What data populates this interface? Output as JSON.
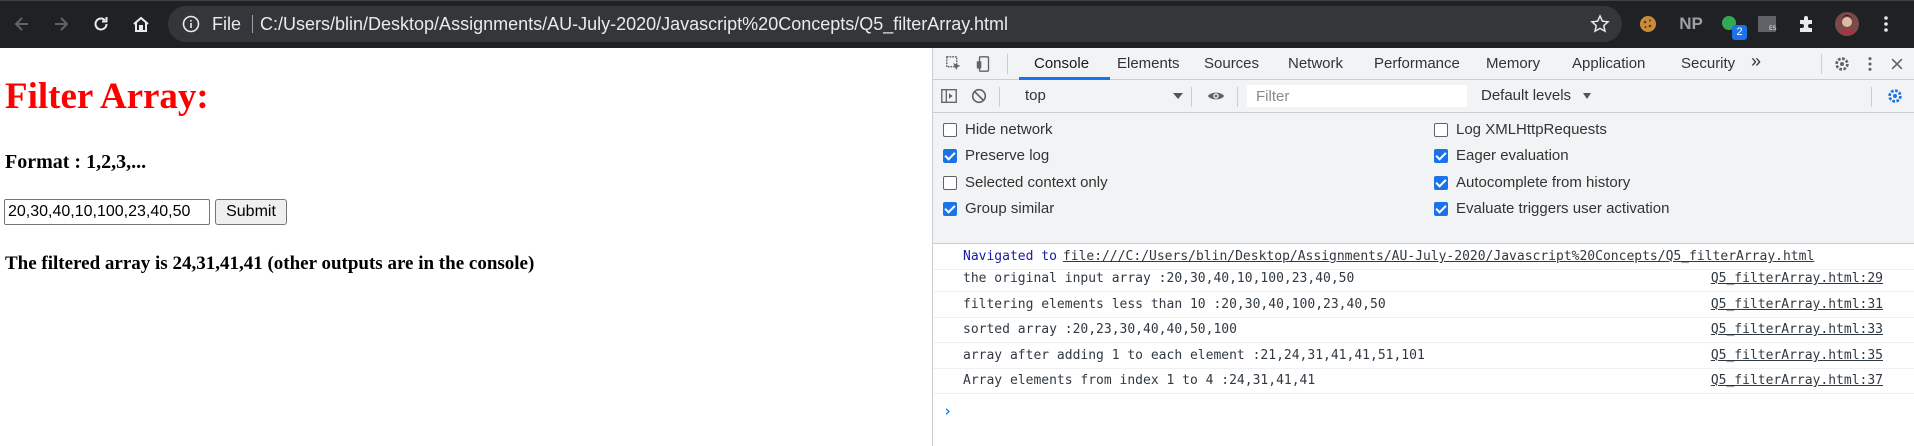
{
  "browser": {
    "scheme": "File",
    "url": "C:/Users/blin/Desktop/Assignments/AU-July-2020/Javascript%20Concepts/Q5_filterArray.html",
    "extensions": {
      "np_label": "NP",
      "badge_count": "2",
      "es_label": "ES"
    }
  },
  "page": {
    "title": "Filter Array:",
    "format": "Format : 1,2,3,...",
    "input_value": "20,30,40,10,100,23,40,50",
    "submit_label": "Submit",
    "result": "The filtered array is 24,31,41,41 (other outputs are in the console)"
  },
  "devtools": {
    "tabs": [
      "Console",
      "Elements",
      "Sources",
      "Network",
      "Performance",
      "Memory",
      "Application",
      "Security"
    ],
    "more_tabs": "»",
    "context": "top",
    "filter_placeholder": "Filter",
    "levels": "Default levels",
    "options_left": [
      {
        "label": "Hide network",
        "checked": false
      },
      {
        "label": "Preserve log",
        "checked": true
      },
      {
        "label": "Selected context only",
        "checked": false
      },
      {
        "label": "Group similar",
        "checked": true
      }
    ],
    "options_right": [
      {
        "label": "Log XMLHttpRequests",
        "checked": false
      },
      {
        "label": "Eager evaluation",
        "checked": true
      },
      {
        "label": "Autocomplete from history",
        "checked": true
      },
      {
        "label": "Evaluate triggers user activation",
        "checked": true
      }
    ],
    "navigated": {
      "prefix": "Navigated to",
      "link": "file:///C:/Users/blin/Desktop/Assignments/AU-July-2020/Javascript%20Concepts/Q5_filterArray.html"
    },
    "messages": [
      {
        "text": "the original input array :20,30,40,10,100,23,40,50",
        "source": "Q5_filterArray.html:29"
      },
      {
        "text": "filtering elements less than 10 :20,30,40,100,23,40,50",
        "source": "Q5_filterArray.html:31"
      },
      {
        "text": "sorted array :20,23,30,40,40,50,100",
        "source": "Q5_filterArray.html:33"
      },
      {
        "text": "array after adding 1 to each element :21,24,31,41,41,51,101",
        "source": "Q5_filterArray.html:35"
      },
      {
        "text": "Array elements from index 1 to 4 :24,31,41,41",
        "source": "Q5_filterArray.html:37"
      }
    ],
    "prompt": "›"
  }
}
